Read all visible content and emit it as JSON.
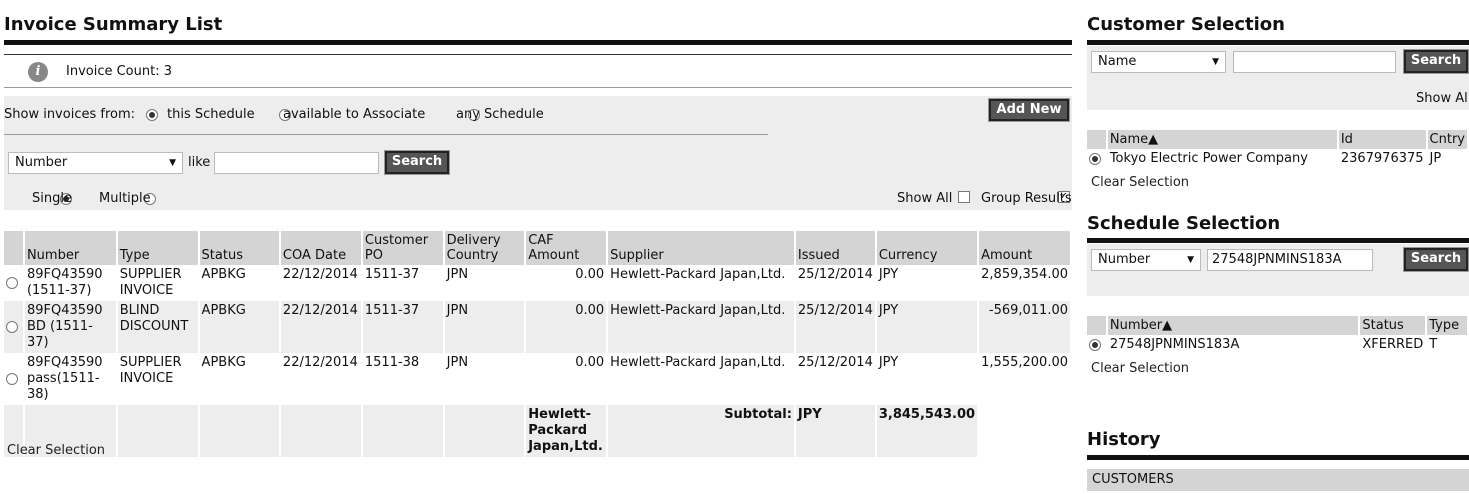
{
  "invoice": {
    "title": "Invoice Summary List",
    "count_label": "Invoice Count: 3",
    "show_from_label": "Show invoices from:",
    "options": [
      "this Schedule",
      "available to Associate",
      "any Schedule"
    ],
    "add_new": "Add New",
    "search_field": "Number",
    "like_label": "like",
    "search_value": "",
    "search_button": "Search",
    "mode_single": "Single",
    "mode_multiple": "Multiple",
    "show_all": "Show All",
    "group_results": "Group Results",
    "columns": [
      "Number",
      "Type",
      "Status",
      "COA Date",
      "Customer PO",
      "Delivery Country",
      "CAF Amount",
      "Supplier",
      "Issued",
      "Currency",
      "Amount"
    ],
    "rows": [
      {
        "number": "89FQ43590 (1511-37)",
        "type": "SUPPLIER INVOICE",
        "status": "APBKG",
        "coa": "22/12/2014",
        "po": "1511-37",
        "country": "JPN",
        "caf": "0.00",
        "supplier": "Hewlett-Packard Japan,Ltd.",
        "issued": "25/12/2014",
        "currency": "JPY",
        "amount": "2,859,354.00"
      },
      {
        "number": "89FQ43590 BD (1511-37)",
        "type": "BLIND DISCOUNT",
        "status": "APBKG",
        "coa": "22/12/2014",
        "po": "1511-37",
        "country": "JPN",
        "caf": "0.00",
        "supplier": "Hewlett-Packard Japan,Ltd.",
        "issued": "25/12/2014",
        "currency": "JPY",
        "amount": "-569,011.00"
      },
      {
        "number": "89FQ43590 pass(1511-38)",
        "type": "SUPPLIER INVOICE",
        "status": "APBKG",
        "coa": "22/12/2014",
        "po": "1511-38",
        "country": "JPN",
        "caf": "0.00",
        "supplier": "Hewlett-Packard Japan,Ltd.",
        "issued": "25/12/2014",
        "currency": "JPY",
        "amount": "1,555,200.00"
      }
    ],
    "subtotal_supplier": "Hewlett-Packard Japan,Ltd.",
    "subtotal_label": "Subtotal:",
    "subtotal_currency": "JPY",
    "subtotal_amount": "3,845,543.00",
    "clear_selection": "Clear Selection"
  },
  "customer": {
    "title": "Customer Selection",
    "search_field": "Name",
    "search_value": "",
    "search_button": "Search",
    "show_all": "Show Al",
    "columns": [
      "Name▲",
      "Id",
      "Cntry"
    ],
    "rows": [
      {
        "name": "Tokyo Electric Power Company",
        "id": "2367976375",
        "cntry": "JP"
      }
    ],
    "clear_selection": "Clear Selection"
  },
  "schedule": {
    "title": "Schedule Selection",
    "search_field": "Number",
    "search_value": "27548JPNMINS183A",
    "search_button": "Search",
    "columns": [
      "Number▲",
      "Status",
      "Type"
    ],
    "rows": [
      {
        "number": "27548JPNMINS183A",
        "status": "XFERRED",
        "type": "T"
      }
    ],
    "clear_selection": "Clear Selection"
  },
  "history": {
    "title": "History",
    "header": "CUSTOMERS"
  },
  "colors": {
    "accent_bar": "#111111",
    "panel": "#ededed",
    "header": "#d4d4d4",
    "button": "#555555"
  }
}
